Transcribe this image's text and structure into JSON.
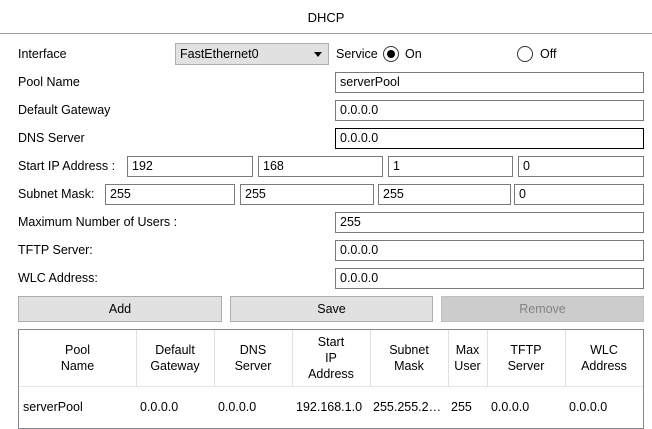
{
  "title": "DHCP",
  "interface": {
    "label": "Interface",
    "value": "FastEthernet0"
  },
  "service": {
    "label": "Service",
    "on_label": "On",
    "off_label": "Off",
    "selected": "On"
  },
  "fields": {
    "pool_name": {
      "label": "Pool Name",
      "value": "serverPool"
    },
    "default_gateway": {
      "label": "Default Gateway",
      "value": "0.0.0.0"
    },
    "dns_server": {
      "label": "DNS Server",
      "value": "0.0.0.0"
    },
    "start_ip": {
      "label": "Start IP Address :",
      "octets": [
        "192",
        "168",
        "1",
        "0"
      ]
    },
    "subnet_mask": {
      "label": "Subnet Mask:",
      "octets": [
        "255",
        "255",
        "255",
        "0"
      ]
    },
    "max_users": {
      "label": "Maximum Number of Users :",
      "value": "255"
    },
    "tftp_server": {
      "label": "TFTP Server:",
      "value": "0.0.0.0"
    },
    "wlc_address": {
      "label": "WLC Address:",
      "value": "0.0.0.0"
    }
  },
  "buttons": {
    "add": "Add",
    "save": "Save",
    "remove": "Remove"
  },
  "table": {
    "headers": [
      "Pool\nName",
      "Default\nGateway",
      "DNS\nServer",
      "Start\nIP\nAddress",
      "Subnet\nMask",
      "Max\nUser",
      "TFTP\nServer",
      "WLC\nAddress"
    ],
    "rows": [
      [
        "serverPool",
        "0.0.0.0",
        "0.0.0.0",
        "192.168.1.0",
        "255.255.2…",
        "255",
        "0.0.0.0",
        "0.0.0.0"
      ]
    ]
  }
}
